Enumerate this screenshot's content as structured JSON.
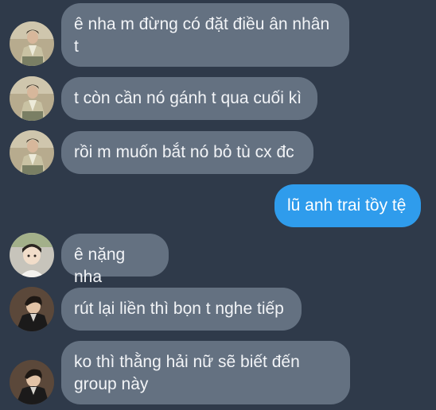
{
  "colors": {
    "background": "#2f3a4a",
    "incoming_bubble": "#647181",
    "outgoing_bubble": "#2f9cec",
    "text": "#f2f4f7"
  },
  "messages": [
    {
      "id": "m1",
      "direction": "incoming",
      "avatar": "user-a-avatar",
      "text": "ê nha m đừng có đặt điều ân nhân t"
    },
    {
      "id": "m2",
      "direction": "incoming",
      "avatar": "user-a-avatar",
      "text": "t còn cần nó gánh t qua cuối kì"
    },
    {
      "id": "m3",
      "direction": "incoming",
      "avatar": "user-a-avatar",
      "text": "rồi m muốn bắt nó bỏ tù cx đc"
    },
    {
      "id": "m4",
      "direction": "outgoing",
      "avatar": "",
      "text": "lũ anh trai tồy tệ"
    },
    {
      "id": "m5",
      "direction": "incoming",
      "avatar": "user-b-avatar",
      "text": "ê nặng nha"
    },
    {
      "id": "m6",
      "direction": "incoming",
      "avatar": "user-c-avatar",
      "text": "rút lại liền thì bọn t nghe tiếp"
    },
    {
      "id": "m7",
      "direction": "incoming",
      "avatar": "user-c-avatar",
      "text": "ko thì thằng hải nữ sẽ biết đến group này"
    }
  ]
}
